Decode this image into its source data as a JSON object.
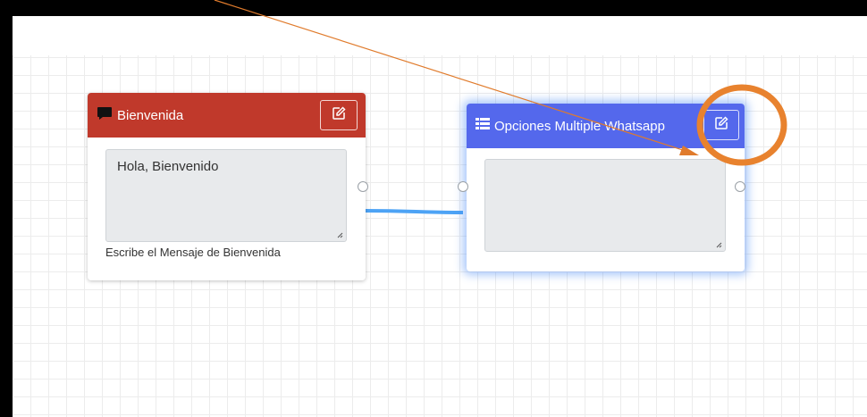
{
  "node_welcome": {
    "title": "Bienvenida",
    "icon": "comment-icon",
    "header_color": "#c0392b",
    "textarea_value": "Hola, Bienvenido",
    "helper_text": "Escribe el Mensaje de Bienvenida"
  },
  "node_options": {
    "title": "Opciones Multiple Whatsapp",
    "icon": "list-icon",
    "header_color": "#5468ec",
    "textarea_value": ""
  },
  "annotation": {
    "arrow_color": "#e07b2c",
    "circle_color": "#e8822e"
  },
  "connection_color": "#4da3f5"
}
